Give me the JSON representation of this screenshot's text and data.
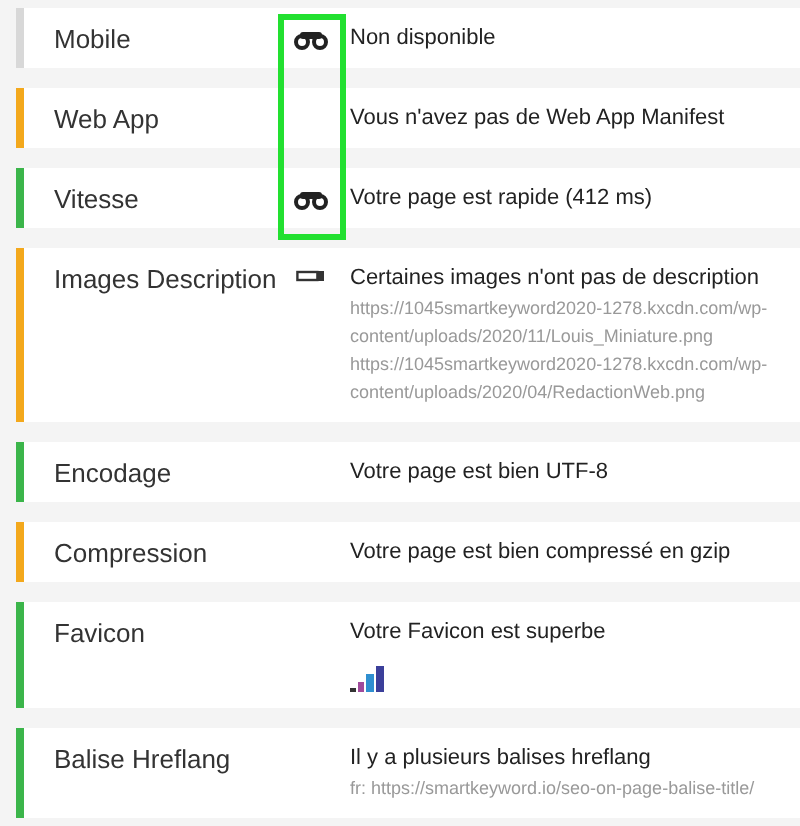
{
  "groups": [
    {
      "highlighted": true,
      "rows": [
        {
          "label": "Mobile",
          "color": "#d8d8d8",
          "kind": "binoculars",
          "message": "Non disponible",
          "details": []
        },
        {
          "label": "Web App",
          "color": "#f3a81c",
          "kind": "plain",
          "message": "Vous n'avez pas de Web App Manifest",
          "details": []
        },
        {
          "label": "Vitesse",
          "color": "#3bb54a",
          "kind": "binoculars",
          "message": "Votre page est rapide (412 ms)",
          "details": []
        }
      ]
    },
    {
      "rows": [
        {
          "label": "Images Description",
          "color": "#f3a81c",
          "kind": "ruler",
          "message": "Certaines images n'ont pas de description",
          "details": [
            "https://1045smartkeyword2020-1278.kxcdn.com/wp-content/uploads/2020/11/Louis_Miniature.png",
            "https://1045smartkeyword2020-1278.kxcdn.com/wp-content/uploads/2020/04/RedactionWeb.png"
          ]
        },
        {
          "label": "Encodage",
          "color": "#3bb54a",
          "kind": "plain",
          "message": "Votre page est bien UTF-8",
          "details": []
        },
        {
          "label": "Compression",
          "color": "#f3a81c",
          "kind": "plain",
          "message": "Votre page est bien compressé en gzip",
          "details": []
        },
        {
          "label": "Favicon",
          "color": "#3bb54a",
          "kind": "favicon",
          "message": "Votre Favicon est superbe",
          "details": []
        },
        {
          "label": "Balise Hreflang",
          "color": "#3bb54a",
          "kind": "plain",
          "message": "Il y a plusieurs balises hreflang",
          "details": [
            "fr: https://smartkeyword.io/seo-on-page-balise-title/"
          ]
        }
      ]
    }
  ]
}
